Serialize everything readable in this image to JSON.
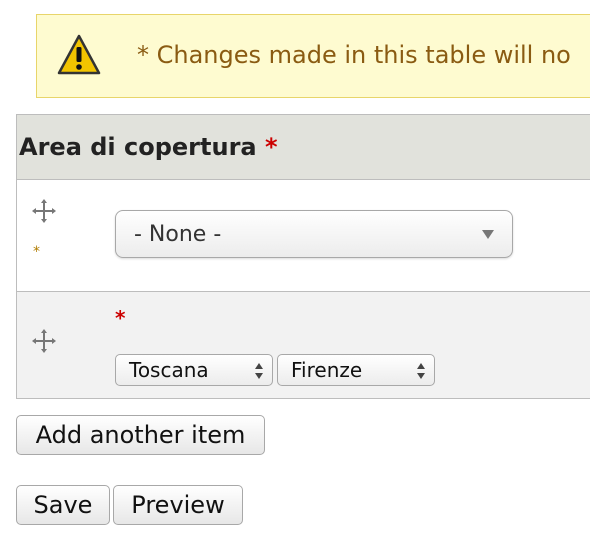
{
  "warning": {
    "icon": "warning-icon",
    "message": "* Changes made in this table will no"
  },
  "field": {
    "label": "Area di copertura",
    "required_mark": "*"
  },
  "rows": [
    {
      "required_mark": "*",
      "select_value": "- None -"
    },
    {
      "required_mark": "*",
      "region_value": "Toscana",
      "city_value": "Firenze"
    }
  ],
  "buttons": {
    "add_another": "Add another item",
    "save": "Save",
    "preview": "Preview"
  },
  "colors": {
    "warning_bg": "#fefbd0",
    "warning_text": "#8a5b12",
    "required": "#cc0000",
    "header_bg": "#e1e2dc"
  }
}
